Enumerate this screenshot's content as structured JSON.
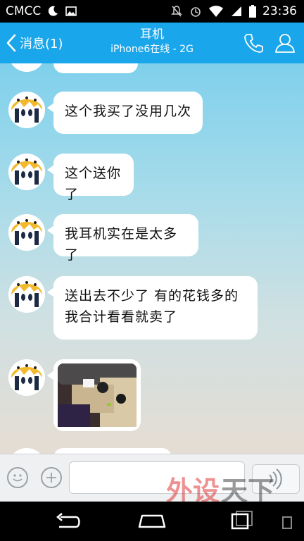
{
  "status_bar": {
    "carrier": "CMCC",
    "time": "23:36",
    "icons": [
      "moon-icon",
      "image-icon",
      "mute-icon",
      "alarm-icon",
      "wifi-icon",
      "signal-icon",
      "battery-icon"
    ]
  },
  "header": {
    "back_label": "消息(1)",
    "title": "耳机",
    "subtitle": "iPhone6在线 - 2G",
    "icons": [
      "phone-icon",
      "profile-icon"
    ],
    "color": "#1aa6ea"
  },
  "messages": [
    {
      "type": "text",
      "text": "这个我买了没用几次"
    },
    {
      "type": "text",
      "text": "这个送你了"
    },
    {
      "type": "text",
      "text": "我耳机实在是太多了"
    },
    {
      "type": "text",
      "lines": [
        "送出去不少了 有的花钱多的",
        "我合计看看就卖了"
      ]
    },
    {
      "type": "image",
      "description_icon": "photo-thumbnail"
    }
  ],
  "input_bar": {
    "emoji_icon": "smiley-icon",
    "plus_icon": "plus-icon",
    "input_value": "",
    "voice_icon": "voice-icon"
  },
  "nav_bar": {
    "icons": [
      "back-icon",
      "home-icon",
      "recents-icon"
    ]
  },
  "watermark": {
    "text": "外设天下",
    "url": "www.pcwaishe.cn"
  }
}
